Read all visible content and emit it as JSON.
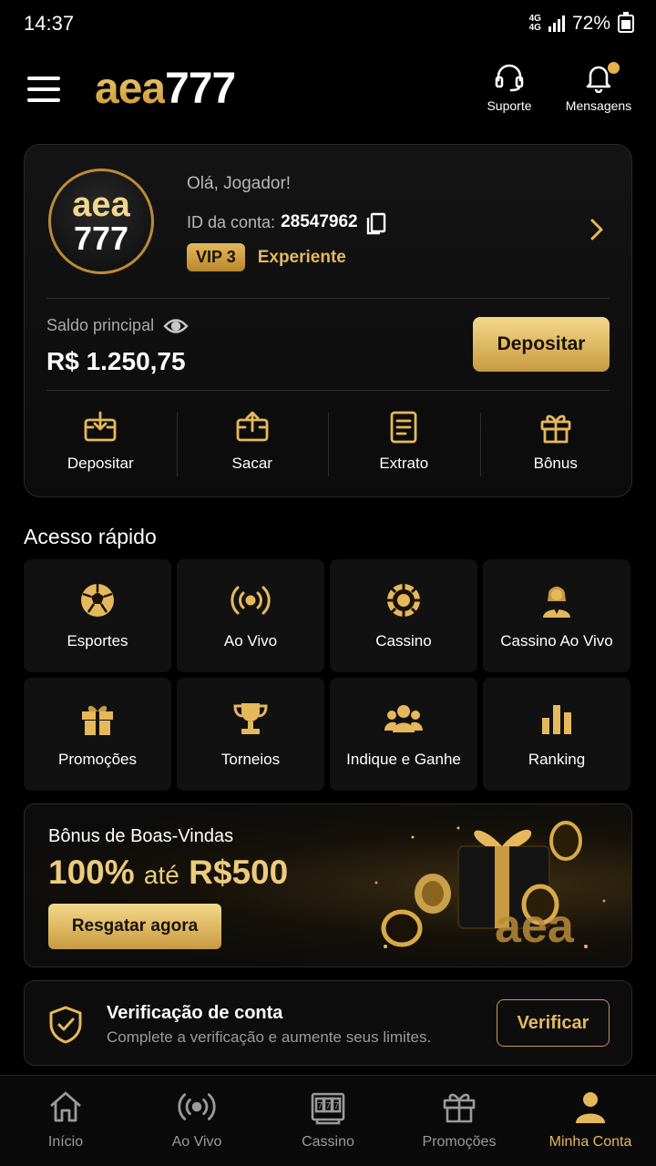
{
  "status": {
    "time": "14:37",
    "network": "4G",
    "battery": "72%"
  },
  "header": {
    "logo_part1": "aea",
    "logo_part2": "777",
    "support_label": "Suporte",
    "messages_label": "Mensagens"
  },
  "account": {
    "avatar_line1": "aea",
    "avatar_line2": "777",
    "greeting": "Olá, Jogador!",
    "id_label": "ID da conta:",
    "id_value": "28547962",
    "vip_badge": "VIP 3",
    "vip_level": "Experiente",
    "balance_label": "Saldo principal",
    "balance_value": "R$ 1.250,75",
    "deposit_button": "Depositar",
    "actions": [
      "Depositar",
      "Sacar",
      "Extrato",
      "Bônus"
    ]
  },
  "quick_access": {
    "title": "Acesso rápido",
    "items": [
      {
        "label": "Esportes",
        "icon": "soccer-ball-icon"
      },
      {
        "label": "Ao Vivo",
        "icon": "live-broadcast-icon"
      },
      {
        "label": "Cassino",
        "icon": "casino-chip-icon"
      },
      {
        "label": "Cassino Ao Vivo",
        "icon": "dealer-icon"
      },
      {
        "label": "Promoções",
        "icon": "gift-icon"
      },
      {
        "label": "Torneios",
        "icon": "trophy-icon"
      },
      {
        "label": "Indique e Ganhe",
        "icon": "users-icon"
      },
      {
        "label": "Ranking",
        "icon": "ranking-icon"
      }
    ]
  },
  "promo": {
    "title": "Bônus de Boas-Vindas",
    "amount1": "100%",
    "connector": "até",
    "amount2": "R$500",
    "button": "Resgatar agora",
    "art_text": "aea"
  },
  "verification": {
    "title": "Verificação de conta",
    "subtitle": "Complete a verificação e aumente seus limites.",
    "button": "Verificar"
  },
  "bottom_nav": [
    "Início",
    "Ao Vivo",
    "Cassino",
    "Promoções",
    "Minha Conta"
  ],
  "colors": {
    "gold": "#e6b85c",
    "gold_light": "#f4d98c",
    "background": "#000000"
  }
}
